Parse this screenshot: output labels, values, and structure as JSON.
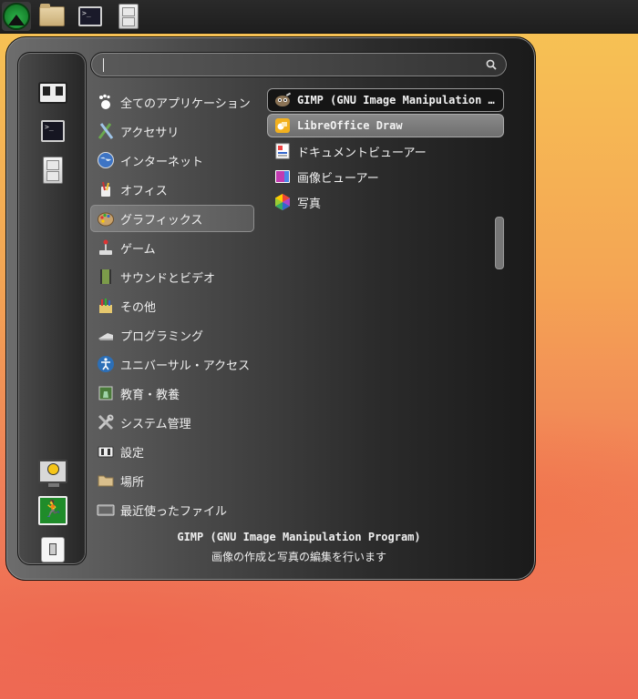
{
  "taskbar": {
    "items": [
      {
        "name": "app-menu",
        "icon": "green-mountain-logo"
      },
      {
        "name": "file-manager",
        "icon": "folder-icon"
      },
      {
        "name": "terminal",
        "icon": "terminal-icon"
      },
      {
        "name": "file-cabinet",
        "icon": "cabinet-icon"
      }
    ]
  },
  "sidebar": {
    "items": [
      {
        "icon": "places-icon"
      },
      {
        "icon": "terminal-icon"
      },
      {
        "icon": "cabinet-icon"
      },
      {
        "icon": "lock-screen-icon"
      },
      {
        "icon": "logout-icon"
      },
      {
        "icon": "power-icon"
      }
    ]
  },
  "search": {
    "value": "",
    "placeholder": ""
  },
  "categories": [
    {
      "label": "全てのアプリケーション",
      "icon": "all-apps-icon"
    },
    {
      "label": "アクセサリ",
      "icon": "accessories-icon"
    },
    {
      "label": "インターネット",
      "icon": "internet-icon"
    },
    {
      "label": "オフィス",
      "icon": "office-icon"
    },
    {
      "label": "グラフィックス",
      "icon": "graphics-icon",
      "selected": true
    },
    {
      "label": "ゲーム",
      "icon": "games-icon"
    },
    {
      "label": "サウンドとビデオ",
      "icon": "multimedia-icon"
    },
    {
      "label": "その他",
      "icon": "other-icon"
    },
    {
      "label": "プログラミング",
      "icon": "programming-icon"
    },
    {
      "label": "ユニバーサル・アクセス",
      "icon": "accessibility-icon"
    },
    {
      "label": "教育・教養",
      "icon": "education-icon"
    },
    {
      "label": "システム管理",
      "icon": "system-icon"
    },
    {
      "label": "設定",
      "icon": "settings-icon"
    },
    {
      "label": "場所",
      "icon": "places-folder-icon"
    },
    {
      "label": "最近使ったファイル",
      "icon": "recent-files-icon"
    }
  ],
  "apps": [
    {
      "label": "GIMP (GNU Image Manipulation …",
      "icon": "gimp-icon"
    },
    {
      "label": "LibreOffice Draw",
      "icon": "libreoffice-draw-icon"
    },
    {
      "label": "ドキュメントビューアー",
      "icon": "document-viewer-icon"
    },
    {
      "label": "画像ビューアー",
      "icon": "image-viewer-icon"
    },
    {
      "label": "写真",
      "icon": "photos-icon"
    }
  ],
  "description": {
    "title": "GIMP (GNU Image Manipulation Program)",
    "subtitle": "画像の作成と写真の編集を行います"
  }
}
